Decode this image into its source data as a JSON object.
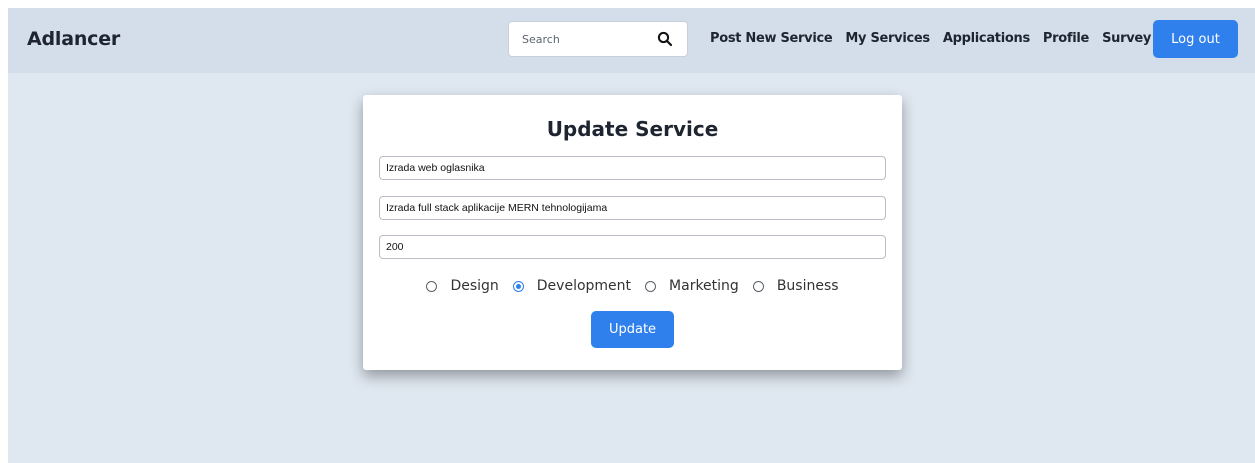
{
  "navbar": {
    "brand": "Adlancer",
    "search": {
      "placeholder": "Search",
      "value": ""
    },
    "links": [
      "Post New Service",
      "My Services",
      "Applications",
      "Profile",
      "Survey"
    ],
    "logout_label": "Log out"
  },
  "form": {
    "title": "Update Service",
    "name_value": "Izrada web oglasnika",
    "description_value": "Izrada full stack aplikacije MERN tehnologijama",
    "price_value": "200",
    "categories": [
      "Design",
      "Development",
      "Marketing",
      "Business"
    ],
    "selected_category": "Development",
    "submit_label": "Update"
  },
  "colors": {
    "accent": "#2f80ed",
    "navbar_bg": "#d3deea",
    "page_bg": "#dfe7f0"
  },
  "icons": {
    "search": "search-icon"
  }
}
